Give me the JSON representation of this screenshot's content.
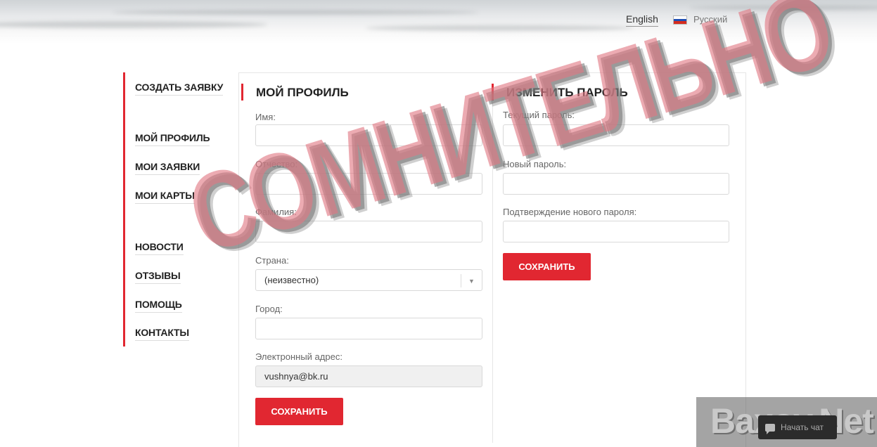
{
  "header": {
    "lang_en": "English",
    "lang_ru": "Русский",
    "flag_colors": [
      "#ffffff",
      "#1f4fb3",
      "#d52b1e"
    ]
  },
  "sidebar": {
    "items": [
      {
        "label": "СОЗДАТЬ ЗАЯВКУ"
      },
      {
        "label": "МОЙ ПРОФИЛЬ"
      },
      {
        "label": "МОИ ЗАЯВКИ"
      },
      {
        "label": "МОИ КАРТЫ"
      },
      {
        "label": "НОВОСТИ"
      },
      {
        "label": "ОТЗЫВЫ"
      },
      {
        "label": "ПОМОЩЬ"
      },
      {
        "label": "КОНТАКТЫ"
      }
    ]
  },
  "profile": {
    "title": "МОЙ ПРОФИЛЬ",
    "first_name_label": "Имя:",
    "first_name_value": "",
    "middle_name_label": "Отчество:",
    "middle_name_value": "",
    "last_name_label": "Фамилия:",
    "last_name_value": "",
    "country_label": "Страна:",
    "country_value": "(неизвестно)",
    "city_label": "Город:",
    "city_value": "",
    "email_label": "Электронный адрес:",
    "email_value": "vushnya@bk.ru",
    "save_label": "СОХРАНИТЬ"
  },
  "password": {
    "title": "ИЗМЕНИТЬ ПАРОЛЬ",
    "current_label": "Текущий пароль:",
    "new_label": "Новый пароль:",
    "confirm_label": "Подтверждение нового пароля:",
    "save_label": "СОХРАНИТЬ"
  },
  "watermark": {
    "stamp_text": "СОМНИТЕЛЬНО",
    "brand_text": "Baxov.Net"
  },
  "chat": {
    "label": "Начать чат"
  },
  "colors": {
    "accent": "#e12731"
  }
}
